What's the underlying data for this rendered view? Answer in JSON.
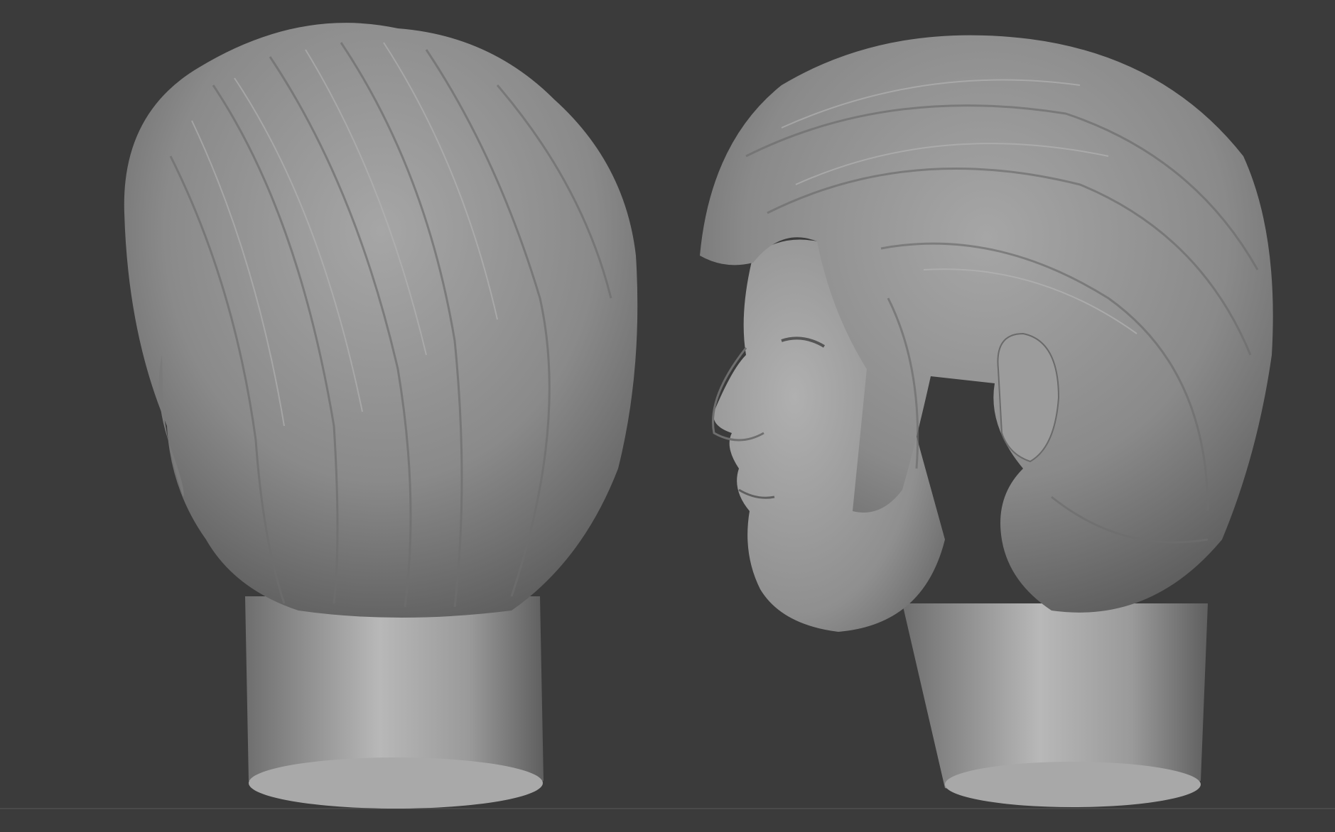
{
  "scene": {
    "background_color": "#3b3b3b",
    "sculpt_color": "#8c8c8c",
    "models": [
      {
        "name": "head-sculpt-back-view"
      },
      {
        "name": "head-sculpt-side-profile-view"
      }
    ]
  }
}
